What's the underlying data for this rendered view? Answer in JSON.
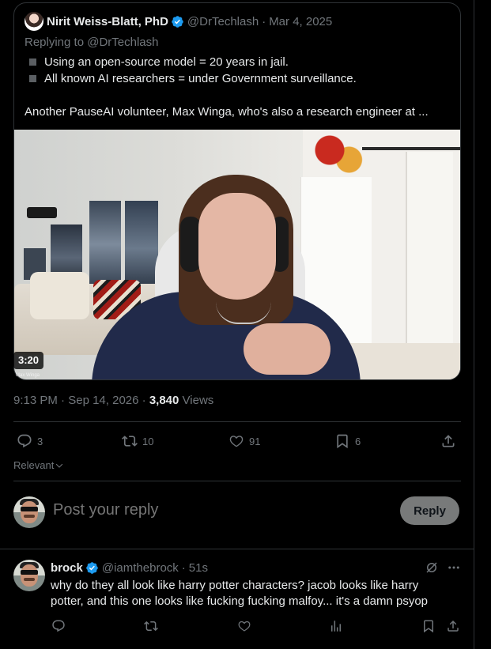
{
  "quoted_tweet": {
    "author_name": "Nirit Weiss-Blatt, PhD",
    "author_handle": "@DrTechlash",
    "separator": "·",
    "date": "Mar 4, 2025",
    "replying_to_prefix": "Replying to ",
    "replying_to_handle": "@DrTechlash",
    "bullets": [
      "Using an open-source model = 20 years in jail.",
      "All known AI researchers = under Government surveillance."
    ],
    "paragraph": "Another PauseAI volunteer, Max Winga, who's also a research engineer at ...",
    "video": {
      "duration": "3:20",
      "watermark": "Max Winga"
    }
  },
  "tweet_meta": {
    "time": "9:13 PM",
    "separator": "·",
    "date": "Sep 14, 2026",
    "sep2": "·",
    "views_count": "3,840",
    "views_label": "Views"
  },
  "actions": {
    "replies": "3",
    "reposts": "10",
    "likes": "91",
    "bookmarks": "6"
  },
  "sort": {
    "label": "Relevant"
  },
  "composer": {
    "placeholder": "Post your reply",
    "button_label": "Reply"
  },
  "reply": {
    "author_name": "brock",
    "author_handle": "@iamthebrock",
    "separator": "·",
    "time": "51s",
    "text": "why do they all look like harry potter characters? jacob looks like harry potter, and this one looks like fucking fucking malfoy... it's a damn psyop"
  },
  "colors": {
    "background": "#000000",
    "border": "#2f3336",
    "text_primary": "#e7e9ea",
    "text_secondary": "#71767b",
    "verified_blue": "#1d9bf0",
    "reply_button_disabled": "#787a7a"
  },
  "icons": {
    "verified": "verified-badge-icon",
    "reply": "reply-icon",
    "repost": "repost-icon",
    "like": "heart-icon",
    "bookmark": "bookmark-icon",
    "share": "share-icon",
    "chevron": "chevron-down-icon",
    "grok": "grok-icon",
    "more": "more-icon",
    "views": "views-icon"
  }
}
